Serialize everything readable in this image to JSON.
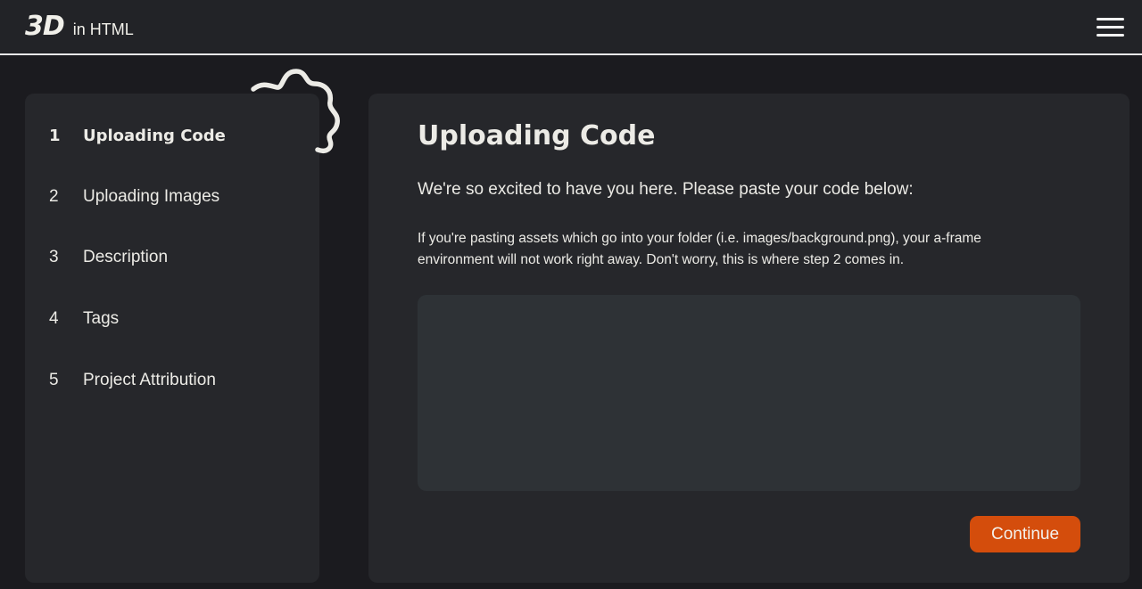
{
  "header": {
    "logo_mark": "3D",
    "logo_text": "in HTML"
  },
  "sidebar": {
    "steps": [
      {
        "number": "1",
        "label": "Uploading Code",
        "active": true
      },
      {
        "number": "2",
        "label": "Uploading Images",
        "active": false
      },
      {
        "number": "3",
        "label": "Description",
        "active": false
      },
      {
        "number": "4",
        "label": "Tags",
        "active": false
      },
      {
        "number": "5",
        "label": "Project Attribution",
        "active": false
      }
    ]
  },
  "main": {
    "title": "Uploading Code",
    "intro": "We're so excited to have you here. Please paste your code below:",
    "note": "If you're pasting assets which go into your folder (i.e. images/background.png), your a-frame environment will not work right away. Don't worry, this is where step 2 comes in.",
    "code_value": "",
    "continue_label": "Continue"
  },
  "colors": {
    "background": "#1b1b1f",
    "header": "#222327",
    "panel": "#26272b",
    "input": "#2e3236",
    "accent": "#d44d0c",
    "text": "#ecebe6"
  },
  "icons": {
    "menu": "hamburger-menu-icon",
    "decoration": "squiggle-decoration-icon"
  }
}
